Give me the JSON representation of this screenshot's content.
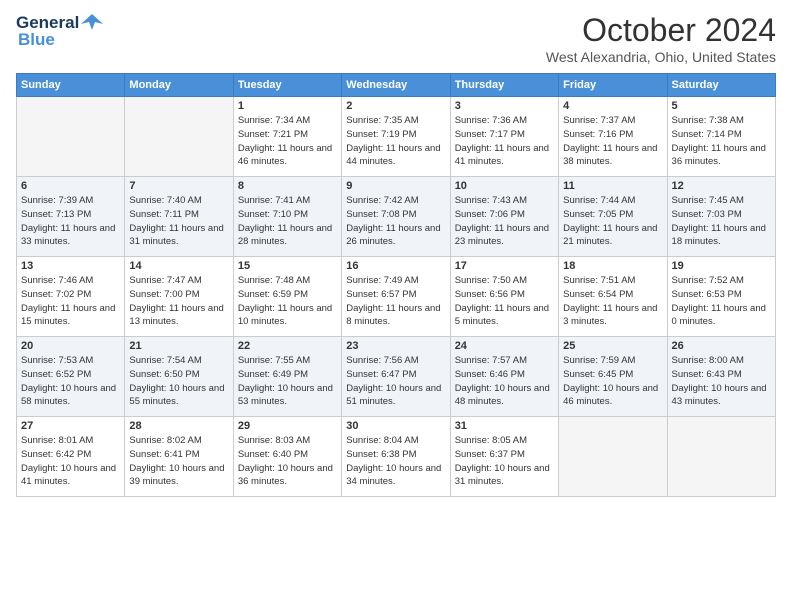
{
  "header": {
    "logo_line1": "General",
    "logo_line2": "Blue",
    "month": "October 2024",
    "location": "West Alexandria, Ohio, United States"
  },
  "days_of_week": [
    "Sunday",
    "Monday",
    "Tuesday",
    "Wednesday",
    "Thursday",
    "Friday",
    "Saturday"
  ],
  "weeks": [
    [
      {
        "day": "",
        "content": ""
      },
      {
        "day": "",
        "content": ""
      },
      {
        "day": "1",
        "content": "Sunrise: 7:34 AM\nSunset: 7:21 PM\nDaylight: 11 hours and 46 minutes."
      },
      {
        "day": "2",
        "content": "Sunrise: 7:35 AM\nSunset: 7:19 PM\nDaylight: 11 hours and 44 minutes."
      },
      {
        "day": "3",
        "content": "Sunrise: 7:36 AM\nSunset: 7:17 PM\nDaylight: 11 hours and 41 minutes."
      },
      {
        "day": "4",
        "content": "Sunrise: 7:37 AM\nSunset: 7:16 PM\nDaylight: 11 hours and 38 minutes."
      },
      {
        "day": "5",
        "content": "Sunrise: 7:38 AM\nSunset: 7:14 PM\nDaylight: 11 hours and 36 minutes."
      }
    ],
    [
      {
        "day": "6",
        "content": "Sunrise: 7:39 AM\nSunset: 7:13 PM\nDaylight: 11 hours and 33 minutes."
      },
      {
        "day": "7",
        "content": "Sunrise: 7:40 AM\nSunset: 7:11 PM\nDaylight: 11 hours and 31 minutes."
      },
      {
        "day": "8",
        "content": "Sunrise: 7:41 AM\nSunset: 7:10 PM\nDaylight: 11 hours and 28 minutes."
      },
      {
        "day": "9",
        "content": "Sunrise: 7:42 AM\nSunset: 7:08 PM\nDaylight: 11 hours and 26 minutes."
      },
      {
        "day": "10",
        "content": "Sunrise: 7:43 AM\nSunset: 7:06 PM\nDaylight: 11 hours and 23 minutes."
      },
      {
        "day": "11",
        "content": "Sunrise: 7:44 AM\nSunset: 7:05 PM\nDaylight: 11 hours and 21 minutes."
      },
      {
        "day": "12",
        "content": "Sunrise: 7:45 AM\nSunset: 7:03 PM\nDaylight: 11 hours and 18 minutes."
      }
    ],
    [
      {
        "day": "13",
        "content": "Sunrise: 7:46 AM\nSunset: 7:02 PM\nDaylight: 11 hours and 15 minutes."
      },
      {
        "day": "14",
        "content": "Sunrise: 7:47 AM\nSunset: 7:00 PM\nDaylight: 11 hours and 13 minutes."
      },
      {
        "day": "15",
        "content": "Sunrise: 7:48 AM\nSunset: 6:59 PM\nDaylight: 11 hours and 10 minutes."
      },
      {
        "day": "16",
        "content": "Sunrise: 7:49 AM\nSunset: 6:57 PM\nDaylight: 11 hours and 8 minutes."
      },
      {
        "day": "17",
        "content": "Sunrise: 7:50 AM\nSunset: 6:56 PM\nDaylight: 11 hours and 5 minutes."
      },
      {
        "day": "18",
        "content": "Sunrise: 7:51 AM\nSunset: 6:54 PM\nDaylight: 11 hours and 3 minutes."
      },
      {
        "day": "19",
        "content": "Sunrise: 7:52 AM\nSunset: 6:53 PM\nDaylight: 11 hours and 0 minutes."
      }
    ],
    [
      {
        "day": "20",
        "content": "Sunrise: 7:53 AM\nSunset: 6:52 PM\nDaylight: 10 hours and 58 minutes."
      },
      {
        "day": "21",
        "content": "Sunrise: 7:54 AM\nSunset: 6:50 PM\nDaylight: 10 hours and 55 minutes."
      },
      {
        "day": "22",
        "content": "Sunrise: 7:55 AM\nSunset: 6:49 PM\nDaylight: 10 hours and 53 minutes."
      },
      {
        "day": "23",
        "content": "Sunrise: 7:56 AM\nSunset: 6:47 PM\nDaylight: 10 hours and 51 minutes."
      },
      {
        "day": "24",
        "content": "Sunrise: 7:57 AM\nSunset: 6:46 PM\nDaylight: 10 hours and 48 minutes."
      },
      {
        "day": "25",
        "content": "Sunrise: 7:59 AM\nSunset: 6:45 PM\nDaylight: 10 hours and 46 minutes."
      },
      {
        "day": "26",
        "content": "Sunrise: 8:00 AM\nSunset: 6:43 PM\nDaylight: 10 hours and 43 minutes."
      }
    ],
    [
      {
        "day": "27",
        "content": "Sunrise: 8:01 AM\nSunset: 6:42 PM\nDaylight: 10 hours and 41 minutes."
      },
      {
        "day": "28",
        "content": "Sunrise: 8:02 AM\nSunset: 6:41 PM\nDaylight: 10 hours and 39 minutes."
      },
      {
        "day": "29",
        "content": "Sunrise: 8:03 AM\nSunset: 6:40 PM\nDaylight: 10 hours and 36 minutes."
      },
      {
        "day": "30",
        "content": "Sunrise: 8:04 AM\nSunset: 6:38 PM\nDaylight: 10 hours and 34 minutes."
      },
      {
        "day": "31",
        "content": "Sunrise: 8:05 AM\nSunset: 6:37 PM\nDaylight: 10 hours and 31 minutes."
      },
      {
        "day": "",
        "content": ""
      },
      {
        "day": "",
        "content": ""
      }
    ]
  ]
}
